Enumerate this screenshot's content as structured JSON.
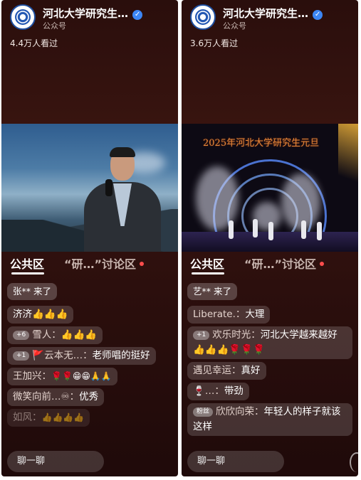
{
  "panels": [
    {
      "account": {
        "name": "河北大学研究生…",
        "type": "公众号",
        "verified_glyph": "✓"
      },
      "viewers": "4.4万人看过",
      "tabs": {
        "public": "公共区",
        "discussion": "“研…”讨论区"
      },
      "comments": [
        {
          "text": "张** 来了"
        },
        {
          "text": "济济👍👍👍"
        },
        {
          "badge": "+6",
          "user": "雪人：",
          "text": "👍👍👍"
        },
        {
          "badge": "+1",
          "flag": "🚩",
          "user": "云本无…：",
          "text": "老师唱的挺好"
        },
        {
          "user": "王加兴：",
          "text": "🌹🌹😁😁🙏🙏"
        },
        {
          "user": "微笑向前…♾：",
          "text": "优秀"
        },
        {
          "user": "如风：",
          "text": "👍👍👍👍"
        }
      ],
      "chat_placeholder": "聊一聊"
    },
    {
      "account": {
        "name": "河北大学研究生…",
        "type": "公众号",
        "verified_glyph": "✓"
      },
      "viewers": "3.6万人看过",
      "stage_title": "2025年河北大学研究生元旦",
      "tabs": {
        "public": "公共区",
        "discussion": "“研…”讨论区"
      },
      "comments": [
        {
          "text": "艺** 来了"
        },
        {
          "user": "Liberate.：",
          "text": "大理"
        },
        {
          "badge": "+1",
          "user": "欢乐时光：",
          "text": "河北大学越来越好👍👍👍🌹🌹🌹"
        },
        {
          "user": "遇见幸运：",
          "text": "真好"
        },
        {
          "flag": "🍷",
          "user": "…：",
          "text": "带劲"
        },
        {
          "badge": "粉丝",
          "user": "欣欣向荣：",
          "text": "年轻人的样子就该这样"
        }
      ],
      "chat_placeholder": "聊一聊"
    }
  ],
  "colors": {
    "background": "#2c0f0d",
    "accent_dot": "#ff4d4d",
    "verified": "#3c86f5"
  },
  "icons": [
    "university-logo-icon",
    "verified-icon"
  ]
}
